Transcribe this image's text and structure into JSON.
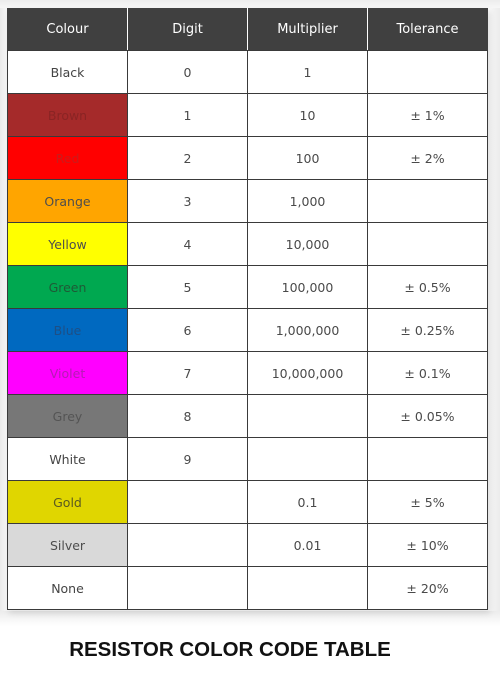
{
  "table": {
    "headers": {
      "colour": "Colour",
      "digit": "Digit",
      "multiplier": "Multiplier",
      "tolerance": "Tolerance"
    },
    "header_bg": "#404040",
    "rows": [
      {
        "colour": "Black",
        "swatch": "#ffffff",
        "text_color": "#444444",
        "digit": "0",
        "multiplier": "1",
        "tolerance": ""
      },
      {
        "colour": "Brown",
        "swatch": "#a52a2a",
        "text_color": "#8a2424",
        "digit": "1",
        "multiplier": "10",
        "tolerance": "± 1%"
      },
      {
        "colour": "Red",
        "swatch": "#ff0000",
        "text_color": "#cc1a1a",
        "digit": "2",
        "multiplier": "100",
        "tolerance": "± 2%"
      },
      {
        "colour": "Orange",
        "swatch": "#ffa500",
        "text_color": "#4d4d4d",
        "digit": "3",
        "multiplier": "1,000",
        "tolerance": ""
      },
      {
        "colour": "Yellow",
        "swatch": "#ffff00",
        "text_color": "#4d4d4d",
        "digit": "4",
        "multiplier": "10,000",
        "tolerance": ""
      },
      {
        "colour": "Green",
        "swatch": "#00a850",
        "text_color": "#1e5a36",
        "digit": "5",
        "multiplier": "100,000",
        "tolerance": "± 0.5%"
      },
      {
        "colour": "Blue",
        "swatch": "#0069c0",
        "text_color": "#1d4f86",
        "digit": "6",
        "multiplier": "1,000,000",
        "tolerance": "± 0.25%"
      },
      {
        "colour": "Violet",
        "swatch": "#ff00ff",
        "text_color": "#b41bb4",
        "digit": "7",
        "multiplier": "10,000,000",
        "tolerance": "± 0.1%"
      },
      {
        "colour": "Grey",
        "swatch": "#777777",
        "text_color": "#545454",
        "digit": "8",
        "multiplier": "",
        "tolerance": "± 0.05%"
      },
      {
        "colour": "White",
        "swatch": "#ffffff",
        "text_color": "#444444",
        "digit": "9",
        "multiplier": "",
        "tolerance": ""
      },
      {
        "colour": "Gold",
        "swatch": "#e0d600",
        "text_color": "#5a5a20",
        "digit": "",
        "multiplier": "0.1",
        "tolerance": "± 5%"
      },
      {
        "colour": "Silver",
        "swatch": "#d9d9d9",
        "text_color": "#4d4d4d",
        "digit": "",
        "multiplier": "0.01",
        "tolerance": "± 10%"
      },
      {
        "colour": "None",
        "swatch": "#ffffff",
        "text_color": "#444444",
        "digit": "",
        "multiplier": "",
        "tolerance": "± 20%"
      }
    ]
  },
  "caption": "RESISTOR COLOR CODE TABLE"
}
